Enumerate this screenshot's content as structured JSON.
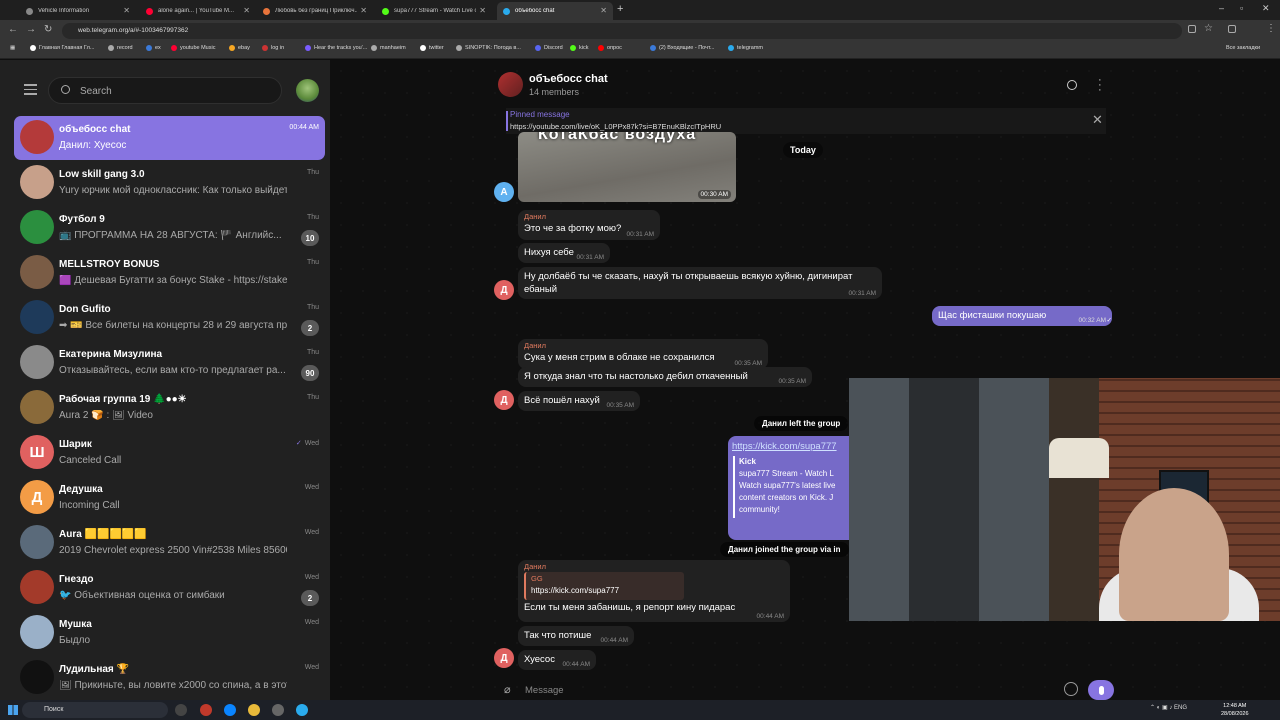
{
  "browser": {
    "tabs": [
      {
        "title": "Vehicle Information",
        "color": "#888888"
      },
      {
        "title": "alone again... | YouTube M...",
        "color": "#ff0033"
      },
      {
        "title": "Любовь без границ Приключ...",
        "color": "#e8743b"
      },
      {
        "title": "supa777 Stream - Watch Live o...",
        "color": "#53fc18"
      },
      {
        "title": "объебосс chat",
        "color": "#2aabee"
      }
    ],
    "url": "web.telegram.org/a/#-1003467997362",
    "bookmarks": [
      "Главная Главная Гл...",
      "record",
      "ex",
      "youtube Music",
      "ebay",
      "log in",
      "Hear the tracks you'...",
      "manhaeim",
      "twitter",
      "SINOPTIK: Погода в...",
      "Discord",
      "kick",
      "опрос",
      "(2) Входящие - Почт...",
      "telegramm"
    ],
    "bookmarks_right": "Все закладки"
  },
  "sidebar": {
    "search_placeholder": "Search",
    "chats": [
      {
        "name": "объебосс chat",
        "preview": "Данил: Хуесос",
        "time": "00:44 AM",
        "badge": "",
        "avatar_color": "#b43a3a",
        "initial": "",
        "selected": true
      },
      {
        "name": "Low skill gang 3.0",
        "preview": "Yury юрчик мой одноклассник: Как только выйдет, о...",
        "time": "Thu",
        "badge": "",
        "avatar_color": "#c7a08a",
        "initial": ""
      },
      {
        "name": "Футбол 9",
        "preview": "📺 ПРОГРАММА НА 28 АВГУСТА: 🏴 Английс...",
        "time": "Thu",
        "badge": "10",
        "avatar_color": "#2b8f3f",
        "initial": ""
      },
      {
        "name": "MELLSTROY BONUS",
        "preview": "🟪 Дешевая Бугатти за бонус Stake - https://stake309...",
        "time": "Thu",
        "badge": "",
        "avatar_color": "#7a5c45",
        "initial": ""
      },
      {
        "name": "Don Gufito",
        "preview": "➡ 🎫 Все билеты на концерты 28 и 29 августа пр...",
        "time": "Thu",
        "badge": "2",
        "avatar_color": "#1e3a5a",
        "initial": ""
      },
      {
        "name": "Екатерина Мизулина",
        "preview": "Отказывайтесь, если вам кто-то предлагает ра...",
        "time": "Thu",
        "badge": "90",
        "avatar_color": "#8a8a8a",
        "initial": ""
      },
      {
        "name": "Рабочая группа 19 🌲●●☀",
        "preview": "Aura 2 🍞 : 🖼 Video",
        "time": "Thu",
        "badge": "",
        "avatar_color": "#8a6a3a",
        "initial": ""
      },
      {
        "name": "Шарик",
        "preview": "Canceled Call",
        "time": "Wed",
        "badge": "",
        "avatar_color": "#e06160",
        "initial": "Ш",
        "check": true
      },
      {
        "name": "Дедушка",
        "preview": "Incoming Call",
        "time": "Wed",
        "badge": "",
        "avatar_color": "#f39c46",
        "initial": "Д"
      },
      {
        "name": "Aura 🟨🟨🟨🟨🟨",
        "preview": "2019 Chevrolet express 2500 Vin#2538 Miles 85600 Car...",
        "time": "Wed",
        "badge": "",
        "avatar_color": "#5a6a7a",
        "initial": ""
      },
      {
        "name": "Гнездо",
        "preview": "🐦 Объективная оценка от симбаки",
        "time": "Wed",
        "badge": "2",
        "avatar_color": "#a33a2a",
        "initial": ""
      },
      {
        "name": "Мушка",
        "preview": "Быдло",
        "time": "Wed",
        "badge": "",
        "avatar_color": "#9ab0c8",
        "initial": ""
      },
      {
        "name": "Лудильная 🏆",
        "preview": "🖼 Прикиньте, вы ловите х2000 со спина, а в этот мо...",
        "time": "Wed",
        "badge": "",
        "avatar_color": "#111111",
        "initial": ""
      }
    ]
  },
  "chat": {
    "title": "объебосс chat",
    "members": "14 members",
    "pinned_label": "Pinned message",
    "pinned_text": "https://youtube.com/live/oK_L0PPx87k?si=B7EnuKBlzcITpHRU",
    "photo_caption": "КотаКбас воздуха",
    "photo_time": "00:30 AM",
    "date_label": "Today",
    "messages": [
      {
        "sender": "Данил",
        "text": "Это че за фотку мою?",
        "time": "00:31 AM"
      },
      {
        "text": "Нихуя себе",
        "time": "00:31 AM"
      },
      {
        "text": "Ну долбаёб ты че сказать, нахуй ты открываешь всякую хуйню, дигинират",
        "text2": "ебаный",
        "time": "00:31 AM"
      },
      {
        "out": true,
        "text": "Щас фисташки покушаю",
        "time": "00:32 AM"
      },
      {
        "sender": "Данил",
        "text": "Сука у меня стрим в облаке не сохранился",
        "time": "00:35 AM"
      },
      {
        "text": "Я откуда знал что ты настолько дебил откаченный",
        "time": "00:35 AM"
      },
      {
        "text": "Всё пошёл нахуй",
        "time": "00:35 AM"
      },
      {
        "sender": "Данил",
        "reply_title": "GG",
        "reply_text": "https://kick.com/supa777",
        "text": "Если ты меня забанишь, я репорт кину пидарас",
        "time": "00:44 AM"
      },
      {
        "text": "Так что потише",
        "time": "00:44 AM"
      },
      {
        "text": "Хуесос",
        "time": "00:44 AM"
      }
    ],
    "service_left": "Данил left the group",
    "service_joined": "Данил joined the group via in",
    "link_url": "https://kick.com/supa777",
    "link_site": "Kick",
    "link_title": "supa777 Stream - Watch L",
    "link_desc1": "Watch supa777's latest live",
    "link_desc2": "content creators on Kick. J",
    "link_desc3": "community!",
    "avatar_letter_a": "A",
    "avatar_letter_d": "Д",
    "input_placeholder": "Message"
  },
  "taskbar": {
    "search": "Поиск",
    "lang": "ENG",
    "time": "12:48 AM",
    "date": "28/08/2026"
  }
}
